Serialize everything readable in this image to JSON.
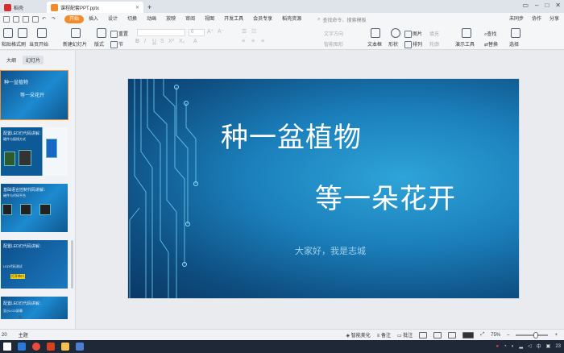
{
  "tabs": {
    "home_label": "稻壳",
    "doc_label": "课程配套PPT.pptx",
    "add_label": "+"
  },
  "menu": {
    "items": [
      "开始",
      "插入",
      "设计",
      "切换",
      "动画",
      "放映",
      "审阅",
      "视图",
      "开发工具",
      "会员专享",
      "稻壳资源"
    ],
    "search_placeholder": "查找命令、搜索模板",
    "sync_label": "未同步",
    "collab_label": "协作",
    "share_label": "分享"
  },
  "ribbon": {
    "paste_label": "粘贴",
    "format_painter_label": "格式刷",
    "play_from_current_label": "当页开始",
    "new_slide_label": "新建幻灯片",
    "layout_label": "版式",
    "reset_label": "重置",
    "section_label": "节",
    "font_size_value": "0",
    "textbox_label": "文本框",
    "shape_label": "形状",
    "image_label": "图片",
    "arrange_label": "排列",
    "fill_label": "填充",
    "outline_label": "轮廓",
    "presenter_label": "演示工具",
    "find_label": "查找",
    "replace_label": "替换",
    "select_label": "选择",
    "text_direction_label": "文字方向",
    "align_text_label": "对齐文本",
    "smartart_label": "智能图形"
  },
  "leftpane": {
    "tab_outline": "大纲",
    "tab_slides": "幻灯片",
    "thumbs": [
      {
        "line1": "种一盆植物",
        "line2": "等一朵花开"
      },
      {
        "line1": "配置LED灯代码讲解：",
        "line2": "硬件与接线方式"
      },
      {
        "line1": "基础语言控制代码讲解：",
        "line2": "硬件与代码平台"
      },
      {
        "line1": "配置LED灯代码讲解：",
        "line2": "LED代码测试",
        "highlight": "打开串口"
      },
      {
        "line1": "配置LED灯代码讲解：",
        "line2": "显示LCD屏幕"
      }
    ],
    "add_label": "+"
  },
  "slide": {
    "title1": "种一盆植物",
    "title2": "等一朵花开",
    "subtitle": "大家好，我是志城"
  },
  "statusbar": {
    "slide_number": "20",
    "theme_label": "主题",
    "beautify_label": "智能美化",
    "notes_label": "备注",
    "comments_label": "批注",
    "zoom_value": "75%"
  },
  "taskbar": {
    "ime_label": "中",
    "clock": "23"
  },
  "colors": {
    "accent": "#f28b28",
    "slide_bg": "#1b7fbb",
    "taskbar": "#1e2836"
  }
}
